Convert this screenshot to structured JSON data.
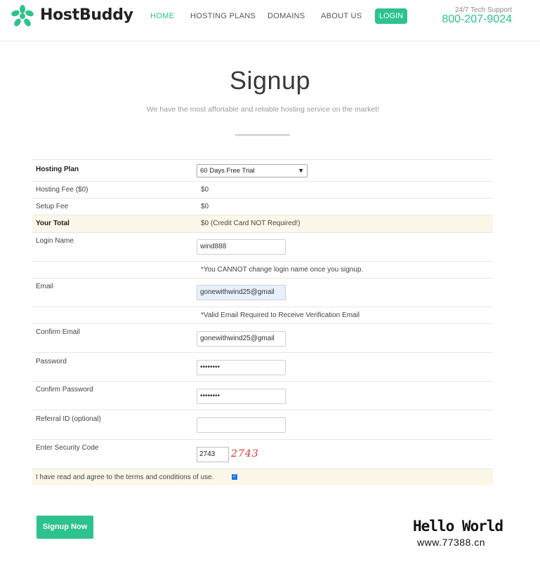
{
  "header": {
    "brand": "HostBuddy",
    "nav": {
      "home": "HOME",
      "plans": "HOSTING PLANS",
      "domains": "DOMAINS",
      "about": "ABOUT US"
    },
    "login": "LOGIN",
    "support_label": "24/7 Tech Support",
    "support_phone": "800-207-9024",
    "accent_color": "#2dc28e"
  },
  "page": {
    "title": "Signup",
    "subtitle": "We have the most affortable and reliable hosting service on the market!"
  },
  "form": {
    "hosting_plan_label": "Hosting Plan",
    "hosting_plan_value": "60 Days Free Trial",
    "hosting_fee_label": "Hosting Fee ($0)",
    "hosting_fee_value": "$0",
    "setup_fee_label": "Setup Fee",
    "setup_fee_value": "$0",
    "total_label": "Your Total",
    "total_value": "$0 (Credit Card NOT Required!)",
    "login_name_label": "Login Name",
    "login_name_value": "wind888",
    "login_name_note": "*You CANNOT change login name once you signup.",
    "email_label": "Email",
    "email_value": "gonewithwind25@gmail",
    "email_note": "*Valid Email Required to Receive Verification Email",
    "confirm_email_label": "Confirm Email",
    "confirm_email_value": "gonewithwind25@gmail",
    "password_label": "Password",
    "password_value": "••••••••",
    "confirm_password_label": "Confirm Password",
    "confirm_password_value": "••••••••",
    "referral_label": "Referral ID (optional)",
    "referral_value": "",
    "security_label": "Enter Security Code",
    "security_value": "2743",
    "captcha_text": "2743",
    "terms_text": "I have read and agree to the terms and conditions of use.",
    "terms_checked": true,
    "submit_label": "Signup Now"
  },
  "watermark": {
    "line1": "Hello World",
    "line2": "www.77388.cn"
  }
}
